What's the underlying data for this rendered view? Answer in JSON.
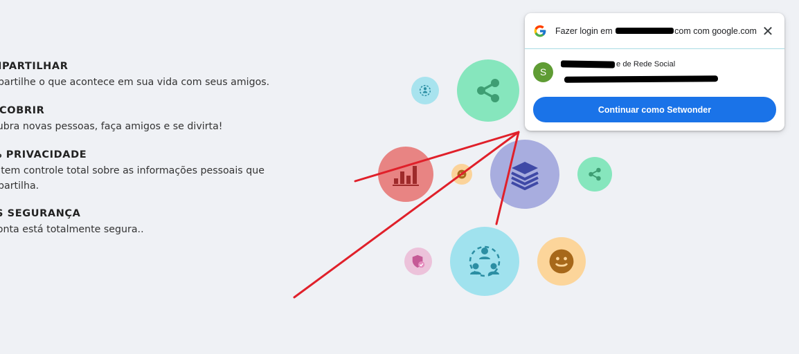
{
  "features": [
    {
      "title": "MPARTILHAR",
      "text": "npartilhe o que acontece em sua vida com seus amigos."
    },
    {
      "title": "SCOBRIR",
      "text": "cubra novas pessoas, faça amigos e se divirta!"
    },
    {
      "title": "% PRIVACIDADE",
      "text": "ê tem controle total sobre as informações pessoais que npartilha."
    },
    {
      "title": "IS SEGURANÇA",
      "text": "conta está totalmente segura.."
    }
  ],
  "icons": {
    "share_large": "share-icon",
    "share_small": "share-icon",
    "stack": "layers-icon",
    "chart": "bar-chart-icon",
    "network": "people-network-icon",
    "smile": "smiley-icon",
    "shield": "shield-check-icon",
    "google": "google-logo-icon",
    "close": "close-icon"
  },
  "colors": {
    "accent_blue": "#1a73e8",
    "arrow_red": "#e0202a",
    "avatar_green": "#5f9c34"
  },
  "popup": {
    "title_prefix": "Fazer login em",
    "title_suffix": "com com google.com",
    "close_label": "✕",
    "account": {
      "avatar_initial": "S",
      "name_suffix": "e de Rede Social"
    },
    "continue_label": "Continuar como Setwonder"
  }
}
